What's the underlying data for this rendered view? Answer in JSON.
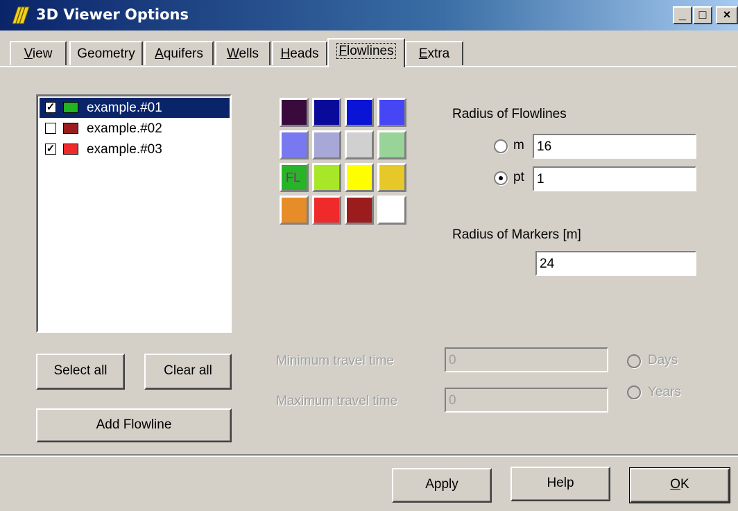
{
  "window": {
    "title": "3D Viewer Options"
  },
  "tabs": [
    {
      "label": "View",
      "underline": "V",
      "rest": "iew",
      "active": false
    },
    {
      "label": "Geometry",
      "underline": "",
      "rest": "Geometry",
      "active": false
    },
    {
      "label": "Aquifers",
      "underline": "A",
      "rest": "quifers",
      "active": false
    },
    {
      "label": "Wells",
      "underline": "W",
      "rest": "ells",
      "active": false
    },
    {
      "label": "Heads",
      "underline": "H",
      "rest": "eads",
      "active": false
    },
    {
      "label": "Flowlines",
      "underline": "F",
      "rest": "lowlines",
      "active": true
    },
    {
      "label": "Extra",
      "underline": "E",
      "rest": "xtra",
      "active": false
    }
  ],
  "flowlines": [
    {
      "label": "example.#01",
      "checked": true,
      "color": "#22b422",
      "selected": true
    },
    {
      "label": "example.#02",
      "checked": false,
      "color": "#9a1c1c",
      "selected": false
    },
    {
      "label": "example.#03",
      "checked": true,
      "color": "#ee2a2a",
      "selected": false
    }
  ],
  "palette": [
    "#3a0a3c",
    "#0a0a9a",
    "#0a14d6",
    "#4646f4",
    "#7878f0",
    "#a8a8d8",
    "#d0d0d0",
    "#98d498",
    "#28b428",
    "#a8e628",
    "#ffff00",
    "#e6c828",
    "#e68c28",
    "#ee2a2a",
    "#9a1c1c",
    "#ffffff"
  ],
  "palette_selected_label": "FL",
  "radius_flowlines": {
    "label": "Radius of Flowlines",
    "options": [
      {
        "label": "m",
        "value": "16",
        "selected": false
      },
      {
        "label": "pt",
        "value": "1",
        "selected": true
      }
    ]
  },
  "radius_markers": {
    "label": "Radius of Markers [m]",
    "value": "24"
  },
  "travel_time": {
    "min_label": "Minimum travel time",
    "min_value": "0",
    "max_label": "Maximum travel time",
    "max_value": "0",
    "unit_days": "Days",
    "unit_years": "Years"
  },
  "buttons": {
    "select_all": "Select all",
    "clear_all": "Clear all",
    "add_flowline": "Add Flowline",
    "apply": "Apply",
    "help": "Help",
    "ok_underline": "O",
    "ok_rest": "K"
  },
  "titlebar_buttons": {
    "minimize": "_",
    "maximize": "□",
    "close": "×"
  }
}
